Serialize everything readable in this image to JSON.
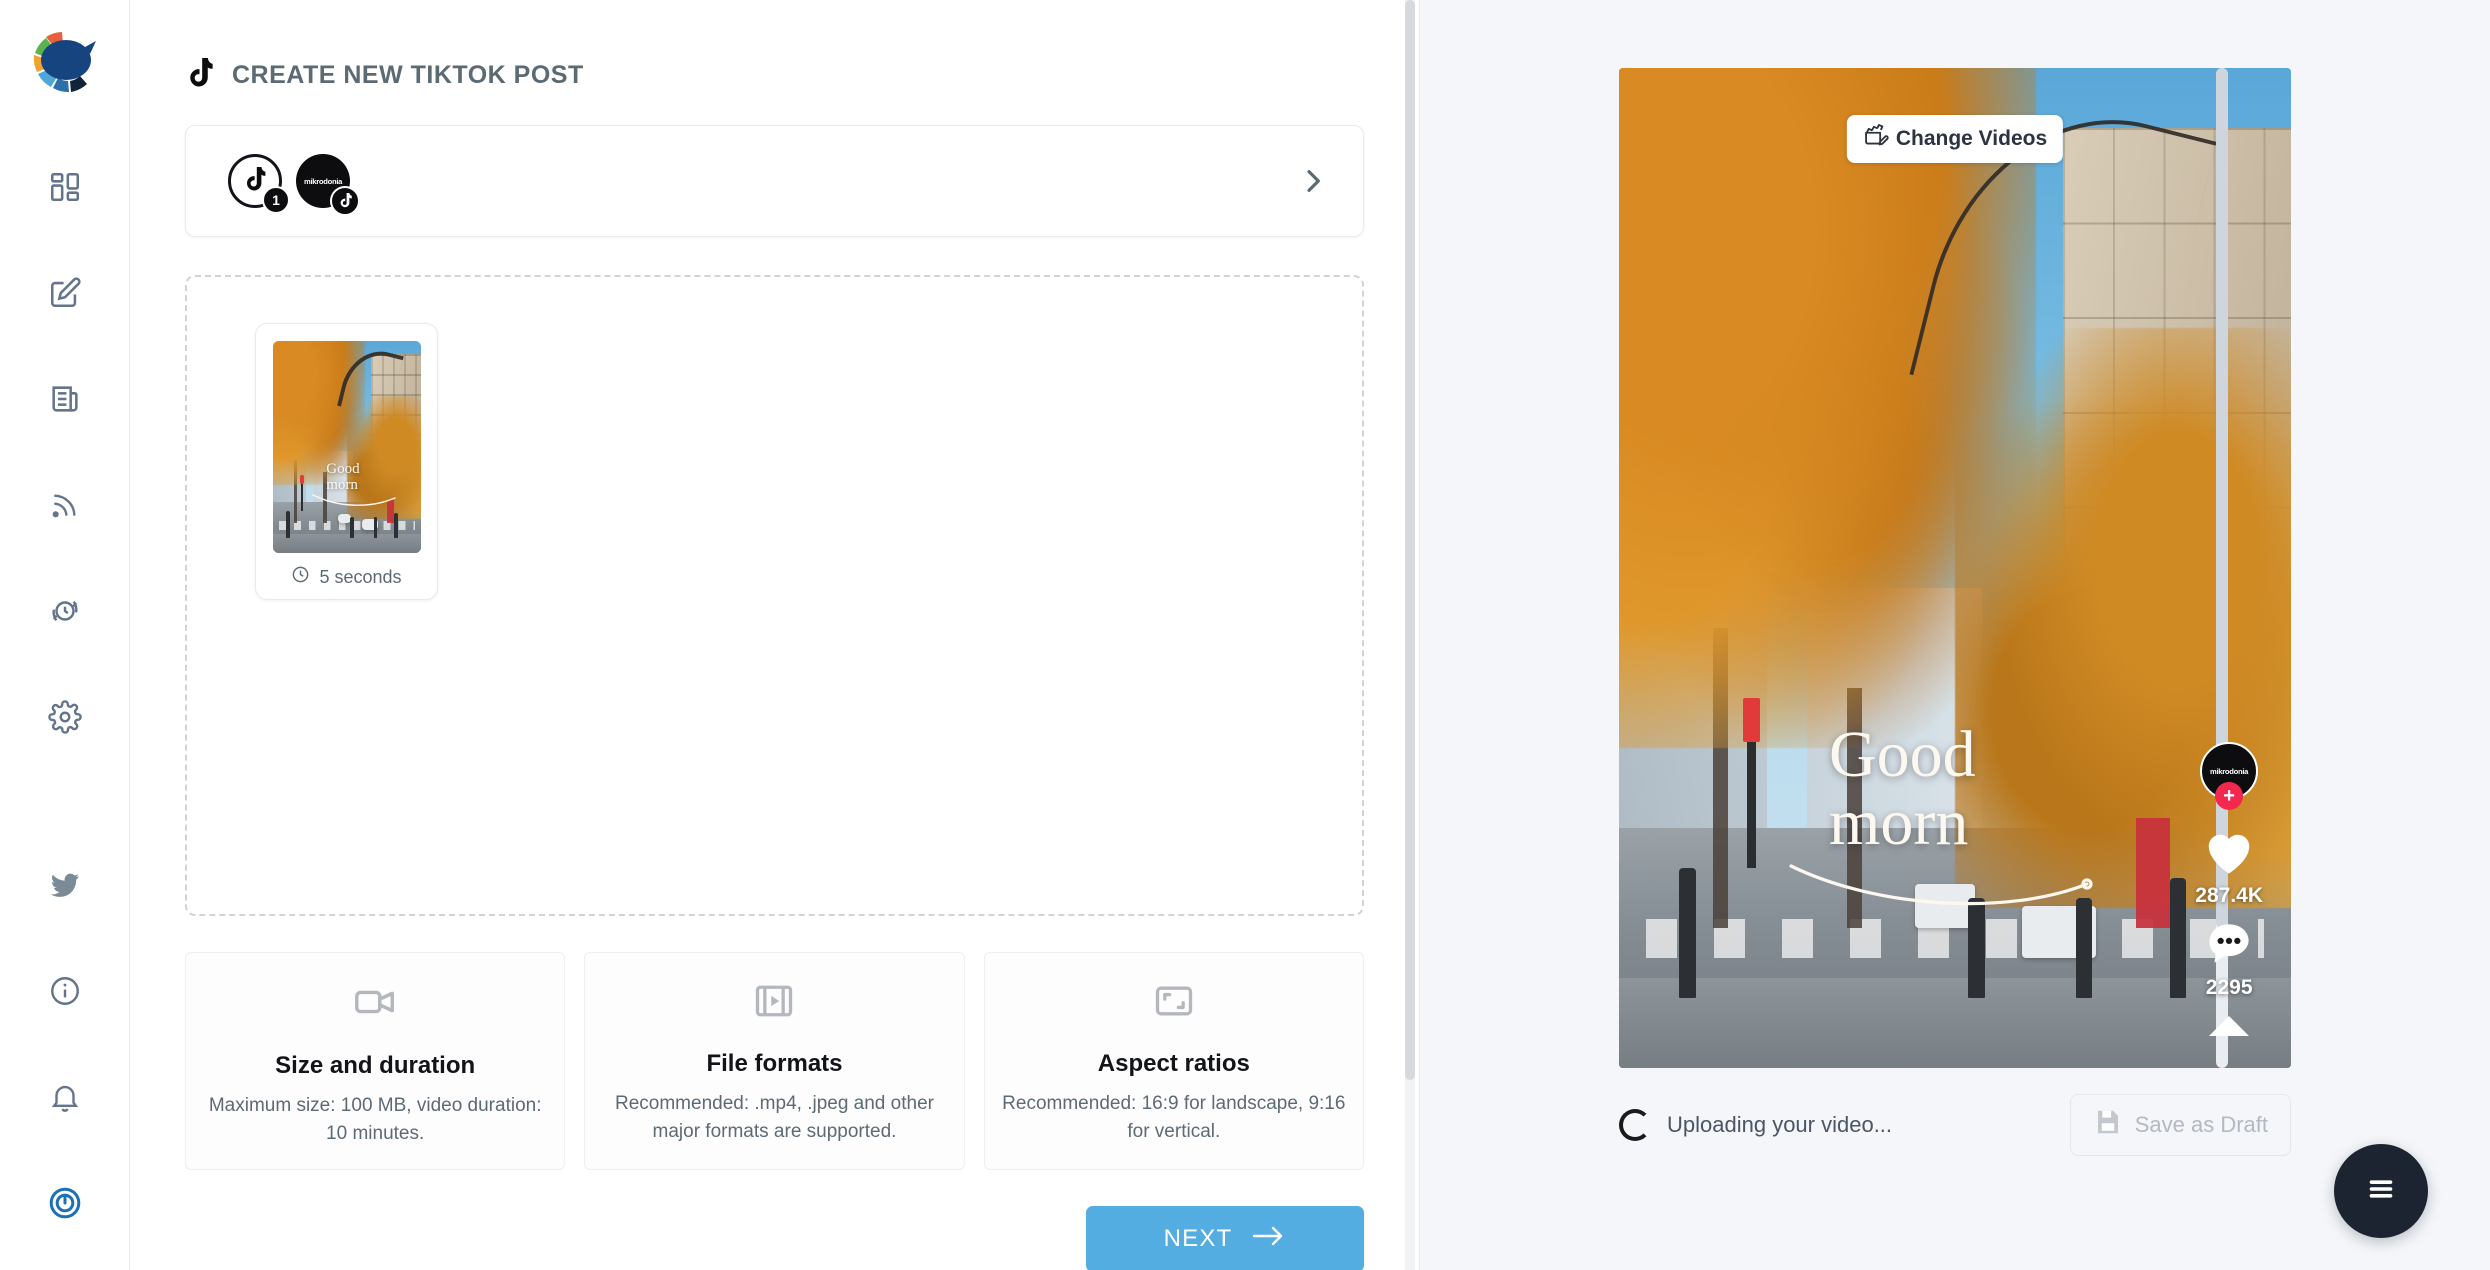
{
  "sidebar": {
    "logo_name": "app-logo",
    "top_items": [
      {
        "name": "dashboard",
        "icon": "dashboard-grid-icon"
      },
      {
        "name": "compose",
        "icon": "compose-edit-icon"
      },
      {
        "name": "content",
        "icon": "newspaper-icon"
      },
      {
        "name": "feeds",
        "icon": "rss-feed-icon"
      },
      {
        "name": "queue",
        "icon": "clock-recycle-icon"
      },
      {
        "name": "settings",
        "icon": "gear-icon"
      }
    ],
    "bottom_items": [
      {
        "name": "twitter",
        "icon": "twitter-bird-icon"
      },
      {
        "name": "info",
        "icon": "info-circle-icon"
      },
      {
        "name": "notifications",
        "icon": "bell-icon"
      },
      {
        "name": "account",
        "icon": "power-spiral-icon"
      }
    ]
  },
  "main": {
    "page_title": "CREATE NEW TIKTOK POST",
    "title_icon": "tiktok-note-icon",
    "accounts": {
      "chevron_icon": "chevron-right-icon",
      "items": [
        {
          "type": "tiktok-outline",
          "badge": "1",
          "badge_type": "count"
        },
        {
          "type": "brand-avatar",
          "brand_text": "mikrodonia",
          "badge_type": "tiktok"
        }
      ]
    },
    "dropzone": {
      "thumb": {
        "duration_label": "5 seconds",
        "clock_icon": "clock-icon",
        "overlay_line1": "Good",
        "overlay_line2": "morn"
      }
    },
    "info_cards": [
      {
        "icon": "video-camera-icon",
        "title": "Size and duration",
        "desc": "Maximum size: 100 MB, video duration: 10 minutes."
      },
      {
        "icon": "film-strip-icon",
        "title": "File formats",
        "desc": "Recommended: .mp4, .jpeg and other major formats are supported."
      },
      {
        "icon": "aspect-ratio-icon",
        "title": "Aspect ratios",
        "desc": "Recommended: 16:9 for landscape, 9:16 for vertical."
      }
    ],
    "next_button": {
      "label": "NEXT",
      "icon": "arrow-right-icon",
      "color": "#54ade0"
    }
  },
  "preview": {
    "change_videos": {
      "label": "Change Videos",
      "icon": "clapperboard-edit-icon"
    },
    "overlay": {
      "line1": "Good",
      "line2": "morn"
    },
    "rail": {
      "avatar_brand_text": "mikrodonia",
      "follow_icon": "plus-icon",
      "follow_color": "#f3284e",
      "like": {
        "icon": "heart-icon",
        "count": "287.4K"
      },
      "comment": {
        "icon": "comment-bubble-icon",
        "count": "2295"
      },
      "share": {
        "icon": "share-arrow-icon"
      }
    },
    "status": {
      "spinner_icon": "loading-spinner-icon",
      "uploading_text": "Uploading your video...",
      "draft_button": {
        "label": "Save as Draft",
        "icon": "floppy-disk-icon"
      }
    },
    "fab": {
      "icon": "hamburger-menu-icon"
    }
  }
}
